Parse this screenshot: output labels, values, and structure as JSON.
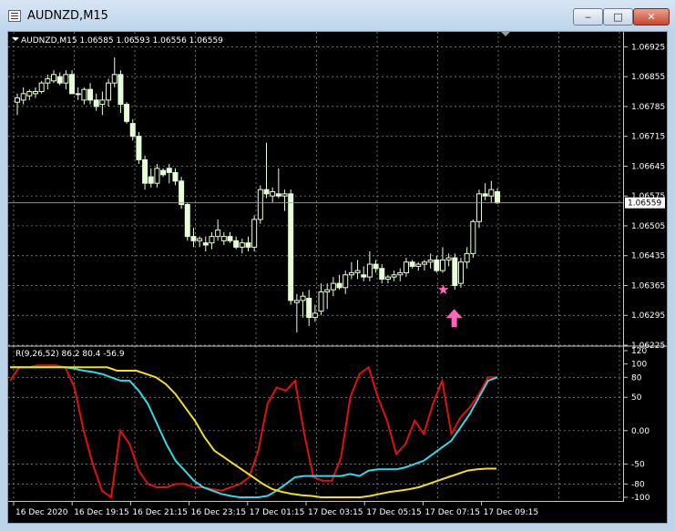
{
  "window": {
    "title": "AUDNZD,M15",
    "minimize_glyph": "‒",
    "maximize_glyph": "□",
    "close_glyph": "✕"
  },
  "price_panel": {
    "header": "AUDNZD,M15  1.06585 1.06593 1.06556 1.06559",
    "current_price": "1.06559",
    "price_ticks": [
      "1.06925",
      "1.06855",
      "1.06785",
      "1.06715",
      "1.06645",
      "1.06575",
      "1.06505",
      "1.06435",
      "1.06365",
      "1.06295",
      "1.06225"
    ],
    "marker_icons": [
      "star-icon",
      "up-arrow-icon"
    ]
  },
  "oscillator_panel": {
    "header": "R(9,26,52) 86.2 80.4 -56.9",
    "ticks": [
      "120",
      "100",
      "80",
      "50",
      "0.00",
      "-50",
      "-80",
      "-100"
    ]
  },
  "time_axis": [
    "16 Dec 2020",
    "16 Dec 19:15",
    "16 Dec 21:15",
    "16 Dec 23:15",
    "17 Dec 01:15",
    "17 Dec 03:15",
    "17 Dec 05:15",
    "17 Dec 07:15",
    "17 Dec 09:15"
  ],
  "colors": {
    "background": "#000000",
    "grid": "#9a9a9a",
    "candle": "#e6ffd6",
    "osc_red": "#e01010",
    "osc_cyan": "#30d8e8",
    "osc_yellow": "#f0e020",
    "marker": "#ff66bb",
    "text": "#ffffff"
  },
  "chart_data": [
    {
      "type": "candlestick",
      "title": "AUDNZD,M15",
      "ylim": [
        1.06225,
        1.0696
      ],
      "candles": [
        {
          "o": 1.06795,
          "h": 1.06815,
          "l": 1.06765,
          "c": 1.06805
        },
        {
          "o": 1.068,
          "h": 1.0683,
          "l": 1.0679,
          "c": 1.06815
        },
        {
          "o": 1.0681,
          "h": 1.06825,
          "l": 1.068,
          "c": 1.0682
        },
        {
          "o": 1.06815,
          "h": 1.0683,
          "l": 1.06805,
          "c": 1.0682
        },
        {
          "o": 1.0682,
          "h": 1.06845,
          "l": 1.06815,
          "c": 1.0684
        },
        {
          "o": 1.0684,
          "h": 1.0686,
          "l": 1.06825,
          "c": 1.0685
        },
        {
          "o": 1.06845,
          "h": 1.0687,
          "l": 1.0684,
          "c": 1.0686
        },
        {
          "o": 1.06855,
          "h": 1.06865,
          "l": 1.06835,
          "c": 1.0684
        },
        {
          "o": 1.0684,
          "h": 1.0687,
          "l": 1.06825,
          "c": 1.0686
        },
        {
          "o": 1.0686,
          "h": 1.0687,
          "l": 1.0682,
          "c": 1.06815
        },
        {
          "o": 1.06815,
          "h": 1.0683,
          "l": 1.068,
          "c": 1.06815
        },
        {
          "o": 1.068,
          "h": 1.0683,
          "l": 1.0679,
          "c": 1.06825
        },
        {
          "o": 1.06825,
          "h": 1.0684,
          "l": 1.0679,
          "c": 1.068
        },
        {
          "o": 1.068,
          "h": 1.06815,
          "l": 1.06775,
          "c": 1.06785
        },
        {
          "o": 1.0679,
          "h": 1.0682,
          "l": 1.06765,
          "c": 1.068
        },
        {
          "o": 1.068,
          "h": 1.0685,
          "l": 1.06785,
          "c": 1.0684
        },
        {
          "o": 1.0684,
          "h": 1.069,
          "l": 1.0683,
          "c": 1.0686
        },
        {
          "o": 1.0686,
          "h": 1.0687,
          "l": 1.0677,
          "c": 1.0679
        },
        {
          "o": 1.0679,
          "h": 1.06795,
          "l": 1.06745,
          "c": 1.0675
        },
        {
          "o": 1.06745,
          "h": 1.06755,
          "l": 1.06705,
          "c": 1.06715
        },
        {
          "o": 1.06715,
          "h": 1.06725,
          "l": 1.0665,
          "c": 1.0666
        },
        {
          "o": 1.0666,
          "h": 1.0667,
          "l": 1.0659,
          "c": 1.06605
        },
        {
          "o": 1.0662,
          "h": 1.0664,
          "l": 1.06595,
          "c": 1.06605
        },
        {
          "o": 1.06605,
          "h": 1.0665,
          "l": 1.06595,
          "c": 1.0664
        },
        {
          "o": 1.06635,
          "h": 1.0664,
          "l": 1.0662,
          "c": 1.06625
        },
        {
          "o": 1.0664,
          "h": 1.0665,
          "l": 1.06605,
          "c": 1.0663
        },
        {
          "o": 1.0663,
          "h": 1.0664,
          "l": 1.066,
          "c": 1.0661
        },
        {
          "o": 1.0661,
          "h": 1.0662,
          "l": 1.06545,
          "c": 1.06555
        },
        {
          "o": 1.06555,
          "h": 1.0656,
          "l": 1.0647,
          "c": 1.0648
        },
        {
          "o": 1.0648,
          "h": 1.065,
          "l": 1.06455,
          "c": 1.0647
        },
        {
          "o": 1.0647,
          "h": 1.0648,
          "l": 1.06455,
          "c": 1.06475
        },
        {
          "o": 1.06465,
          "h": 1.0648,
          "l": 1.06445,
          "c": 1.0646
        },
        {
          "o": 1.06465,
          "h": 1.0649,
          "l": 1.0645,
          "c": 1.0648
        },
        {
          "o": 1.0648,
          "h": 1.0652,
          "l": 1.0647,
          "c": 1.06495
        },
        {
          "o": 1.0647,
          "h": 1.0649,
          "l": 1.0646,
          "c": 1.0648
        },
        {
          "o": 1.0648,
          "h": 1.0649,
          "l": 1.06465,
          "c": 1.0647
        },
        {
          "o": 1.0647,
          "h": 1.0648,
          "l": 1.0645,
          "c": 1.06455
        },
        {
          "o": 1.06455,
          "h": 1.06475,
          "l": 1.0644,
          "c": 1.06465
        },
        {
          "o": 1.06465,
          "h": 1.0648,
          "l": 1.06445,
          "c": 1.06455
        },
        {
          "o": 1.06455,
          "h": 1.0653,
          "l": 1.06445,
          "c": 1.0652
        },
        {
          "o": 1.0652,
          "h": 1.066,
          "l": 1.0651,
          "c": 1.0659
        },
        {
          "o": 1.0659,
          "h": 1.067,
          "l": 1.0657,
          "c": 1.0658
        },
        {
          "o": 1.06575,
          "h": 1.06595,
          "l": 1.0656,
          "c": 1.06585
        },
        {
          "o": 1.0658,
          "h": 1.0664,
          "l": 1.0657,
          "c": 1.06575
        },
        {
          "o": 1.06575,
          "h": 1.0659,
          "l": 1.0654,
          "c": 1.0658
        },
        {
          "o": 1.0658,
          "h": 1.0659,
          "l": 1.0632,
          "c": 1.0633
        },
        {
          "o": 1.06325,
          "h": 1.06345,
          "l": 1.06255,
          "c": 1.0633
        },
        {
          "o": 1.0633,
          "h": 1.0635,
          "l": 1.0629,
          "c": 1.0634
        },
        {
          "o": 1.06335,
          "h": 1.06355,
          "l": 1.0627,
          "c": 1.0629
        },
        {
          "o": 1.0629,
          "h": 1.0632,
          "l": 1.0628,
          "c": 1.063
        },
        {
          "o": 1.06305,
          "h": 1.0637,
          "l": 1.06295,
          "c": 1.0635
        },
        {
          "o": 1.0635,
          "h": 1.0637,
          "l": 1.0631,
          "c": 1.06355
        },
        {
          "o": 1.06355,
          "h": 1.06385,
          "l": 1.0634,
          "c": 1.0637
        },
        {
          "o": 1.0637,
          "h": 1.0639,
          "l": 1.06355,
          "c": 1.0636
        },
        {
          "o": 1.0636,
          "h": 1.064,
          "l": 1.06345,
          "c": 1.0639
        },
        {
          "o": 1.0639,
          "h": 1.0642,
          "l": 1.0638,
          "c": 1.06395
        },
        {
          "o": 1.06395,
          "h": 1.06425,
          "l": 1.0638,
          "c": 1.064
        },
        {
          "o": 1.0639,
          "h": 1.0641,
          "l": 1.06375,
          "c": 1.06385
        },
        {
          "o": 1.06385,
          "h": 1.06445,
          "l": 1.06375,
          "c": 1.06415
        },
        {
          "o": 1.06415,
          "h": 1.06425,
          "l": 1.06395,
          "c": 1.06405
        },
        {
          "o": 1.06405,
          "h": 1.06415,
          "l": 1.0637,
          "c": 1.0638
        },
        {
          "o": 1.0638,
          "h": 1.0639,
          "l": 1.0637,
          "c": 1.06385
        },
        {
          "o": 1.06385,
          "h": 1.064,
          "l": 1.06375,
          "c": 1.0639
        },
        {
          "o": 1.0639,
          "h": 1.06405,
          "l": 1.06375,
          "c": 1.06395
        },
        {
          "o": 1.06395,
          "h": 1.0643,
          "l": 1.06385,
          "c": 1.0642
        },
        {
          "o": 1.0642,
          "h": 1.06425,
          "l": 1.06405,
          "c": 1.0641
        },
        {
          "o": 1.0641,
          "h": 1.0642,
          "l": 1.064,
          "c": 1.06415
        },
        {
          "o": 1.06415,
          "h": 1.06425,
          "l": 1.064,
          "c": 1.0642
        },
        {
          "o": 1.0642,
          "h": 1.0644,
          "l": 1.06405,
          "c": 1.06425
        },
        {
          "o": 1.06425,
          "h": 1.06435,
          "l": 1.06395,
          "c": 1.064
        },
        {
          "o": 1.064,
          "h": 1.06455,
          "l": 1.06395,
          "c": 1.06425
        },
        {
          "o": 1.06425,
          "h": 1.0644,
          "l": 1.0641,
          "c": 1.0643
        },
        {
          "o": 1.0643,
          "h": 1.0644,
          "l": 1.06355,
          "c": 1.06365
        },
        {
          "o": 1.0637,
          "h": 1.0643,
          "l": 1.0636,
          "c": 1.0642
        },
        {
          "o": 1.0642,
          "h": 1.06455,
          "l": 1.06405,
          "c": 1.0644
        },
        {
          "o": 1.0644,
          "h": 1.0652,
          "l": 1.0643,
          "c": 1.06515
        },
        {
          "o": 1.06515,
          "h": 1.0659,
          "l": 1.065,
          "c": 1.0658
        },
        {
          "o": 1.0658,
          "h": 1.06605,
          "l": 1.06565,
          "c": 1.06575
        },
        {
          "o": 1.06575,
          "h": 1.0661,
          "l": 1.0656,
          "c": 1.0659
        },
        {
          "o": 1.06585,
          "h": 1.06593,
          "l": 1.06556,
          "c": 1.06559
        }
      ],
      "markers": [
        {
          "type": "star",
          "candle": 71,
          "price": 1.06355
        },
        {
          "type": "up-arrow",
          "candle": 71,
          "price": 1.0631
        }
      ]
    },
    {
      "type": "line",
      "title": "R(9,26,52)",
      "ylim": [
        -100,
        120
      ],
      "series": [
        {
          "name": "red",
          "values": [
            75,
            95,
            95,
            98,
            98,
            98,
            95,
            65,
            0,
            -50,
            -90,
            -100,
            0,
            -20,
            -60,
            -80,
            -85,
            -85,
            -80,
            -80,
            -85,
            -85,
            -88,
            -90,
            -85,
            -80,
            -70,
            -30,
            40,
            65,
            60,
            75,
            -5,
            -70,
            -75,
            -75,
            -40,
            50,
            85,
            95,
            50,
            15,
            -35,
            -20,
            15,
            -5,
            40,
            75,
            -5,
            20,
            35,
            55,
            80,
            80
          ]
        },
        {
          "name": "cyan",
          "values": [
            95,
            95,
            95,
            95,
            95,
            95,
            95,
            93,
            90,
            88,
            85,
            80,
            75,
            75,
            60,
            40,
            10,
            -20,
            -45,
            -60,
            -75,
            -85,
            -90,
            -95,
            -98,
            -100,
            -100,
            -100,
            -98,
            -90,
            -80,
            -70,
            -68,
            -68,
            -68,
            -68,
            -68,
            -65,
            -68,
            -60,
            -58,
            -58,
            -58,
            -55,
            -50,
            -45,
            -35,
            -25,
            -15,
            5,
            25,
            50,
            75,
            80
          ]
        },
        {
          "name": "yellow",
          "values": [
            95,
            95,
            95,
            95,
            95,
            95,
            95,
            95,
            95,
            95,
            95,
            90,
            90,
            90,
            85,
            80,
            70,
            55,
            35,
            15,
            -10,
            -30,
            -40,
            -50,
            -60,
            -70,
            -80,
            -88,
            -92,
            -95,
            -97,
            -98,
            -100,
            -100,
            -100,
            -100,
            -100,
            -98,
            -95,
            -92,
            -90,
            -88,
            -85,
            -80,
            -75,
            -70,
            -65,
            -60,
            -58,
            -57,
            -57
          ]
        }
      ]
    }
  ]
}
